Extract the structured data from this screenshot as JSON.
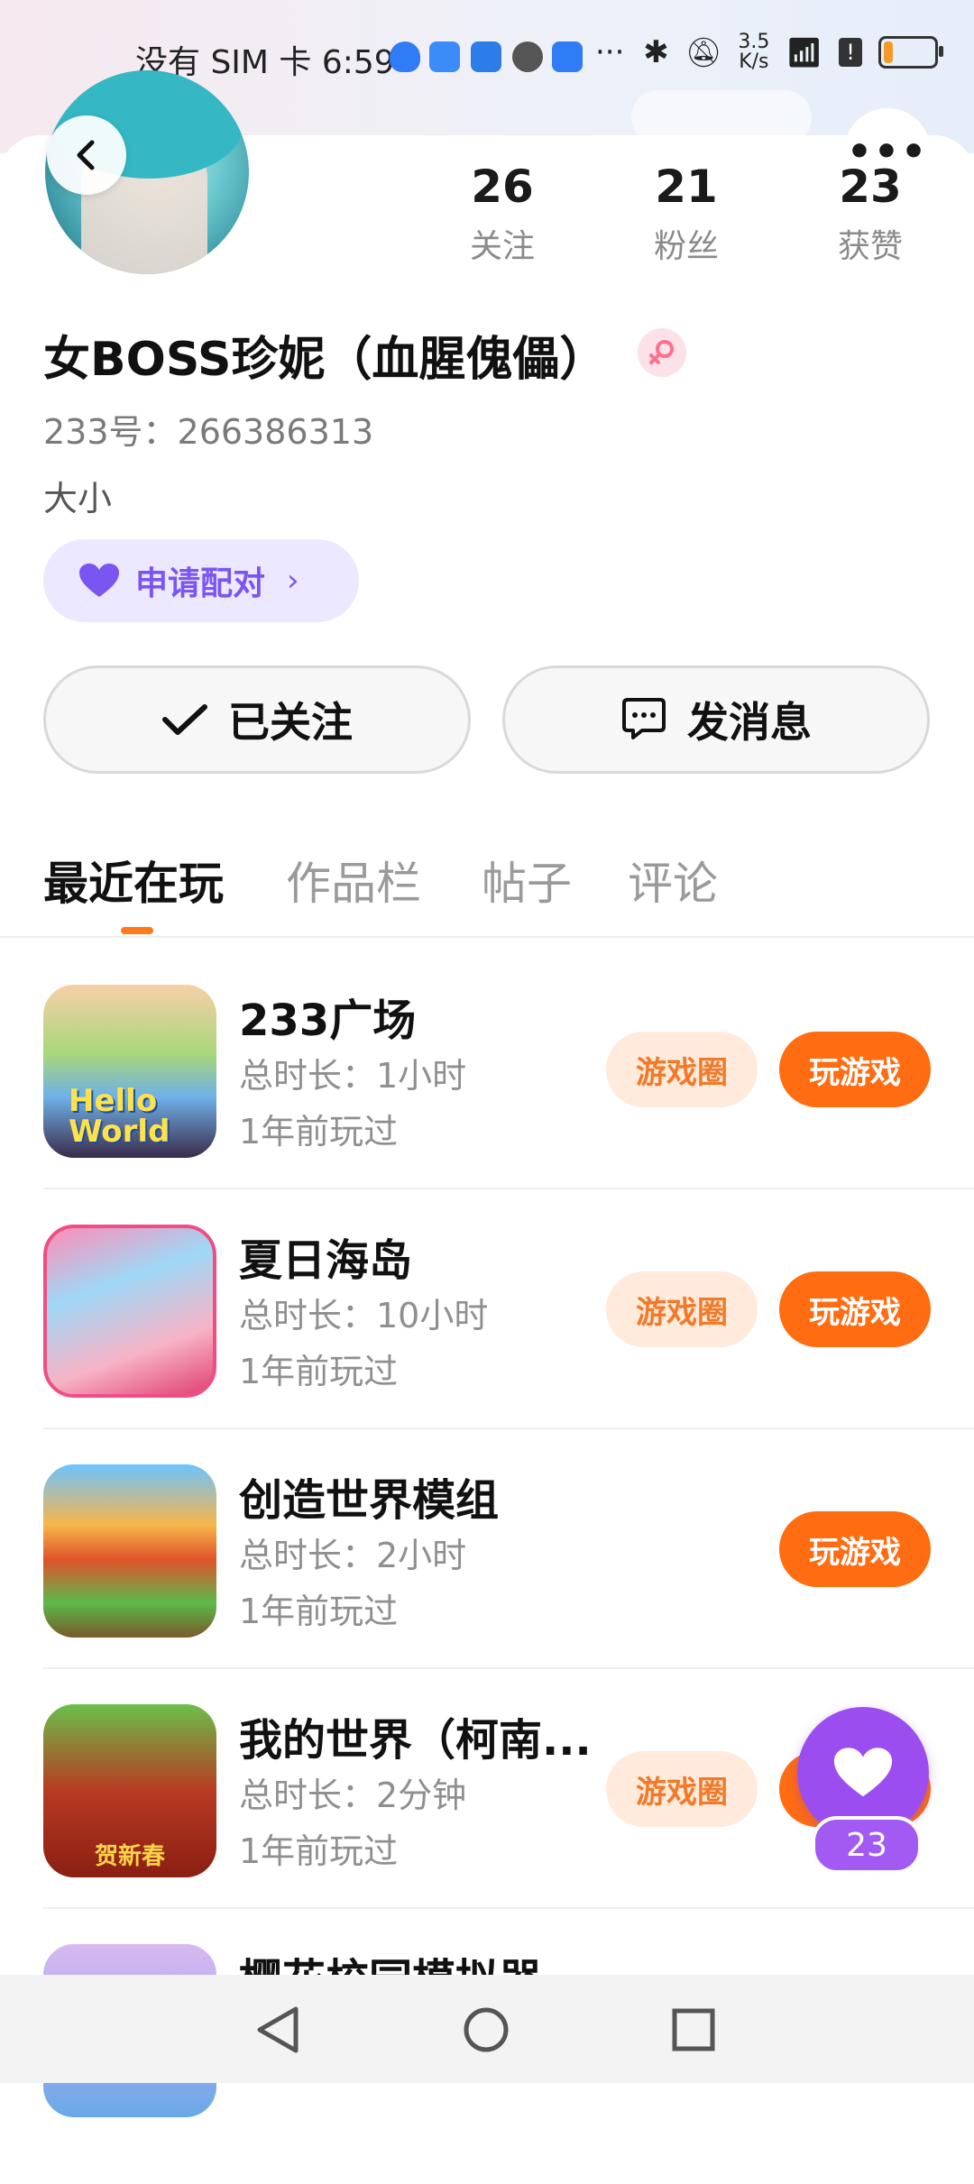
{
  "status_bar": {
    "carrier_time": "没有 SIM 卡 6:59",
    "net_speed": "3.5\nK/s",
    "battery_level": 0.2
  },
  "profile": {
    "stats": [
      {
        "value": "26",
        "label": "关注"
      },
      {
        "value": "21",
        "label": "粉丝"
      },
      {
        "value": "23",
        "label": "获赞"
      }
    ],
    "name": "女BOSS珍妮（血腥傀儡）",
    "uid": "233号：266386313",
    "bio": "大小",
    "pair_label": "申请配对",
    "follow_label": "已关注",
    "message_label": "发消息"
  },
  "tabs": [
    "最近在玩",
    "作品栏",
    "帖子",
    "评论"
  ],
  "games": [
    {
      "title": "233广场",
      "duration": "总时长：1小时",
      "last_played": "1年前玩过",
      "circle": "游戏圈",
      "play": "玩游戏"
    },
    {
      "title": "夏日海岛",
      "duration": "总时长：10小时",
      "last_played": "1年前玩过",
      "circle": "游戏圈",
      "play": "玩游戏"
    },
    {
      "title": "创造世界模组",
      "duration": "总时长：2小时",
      "last_played": "1年前玩过",
      "circle": "",
      "play": "玩游戏"
    },
    {
      "title": "我的世界（柯南...",
      "duration": "总时长：2分钟",
      "last_played": "1年前玩过",
      "circle": "游戏圈",
      "play": "玩游戏"
    },
    {
      "title": "樱花校园模拟器"
    }
  ],
  "like_count": "23",
  "colors": {
    "accent": "#ff6c12",
    "pair_purple": "#7b55f0",
    "fab_purple": "#9b4df0"
  }
}
